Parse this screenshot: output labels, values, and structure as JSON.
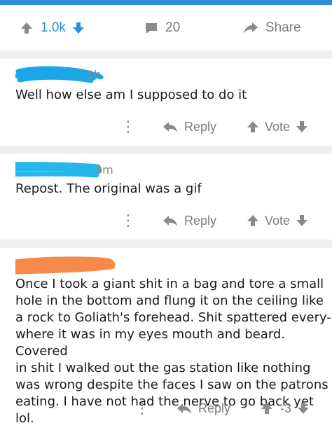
{
  "post": {
    "score": "1.0k",
    "comment_count": "20",
    "share_label": "Share",
    "brand_color": "#2f8cdf",
    "icons": [
      "upvote-icon",
      "downvote-icon",
      "comment-icon",
      "share-icon"
    ]
  },
  "comments": [
    {
      "age": "1h",
      "body": "Well how else am I supposed to do it",
      "reply_label": "Reply",
      "vote_label": "Vote",
      "scribble_color": "#1aa7e8"
    },
    {
      "age": "9m",
      "body": "Repost. The original was a gif",
      "reply_label": "Reply",
      "vote_label": "Vote",
      "scribble_color": "#26b7ea"
    },
    {
      "age": "",
      "body_lines": [
        "Once I took a giant shit in a bag and tore a small",
        "hole in the bottom and flung it on the ceiling like",
        "a rock to Goliath's forehead. Shit spattered every-",
        "where it was in my eyes mouth and beard. Covered",
        "in shit I walked out the gas station like nothing",
        "was wrong despite the faces I saw on the patrons",
        "eating. I have not had the nerve to go back yet lol."
      ],
      "reply_label": "Reply",
      "score": "-3",
      "scribble_color": "#f58a4b"
    }
  ]
}
